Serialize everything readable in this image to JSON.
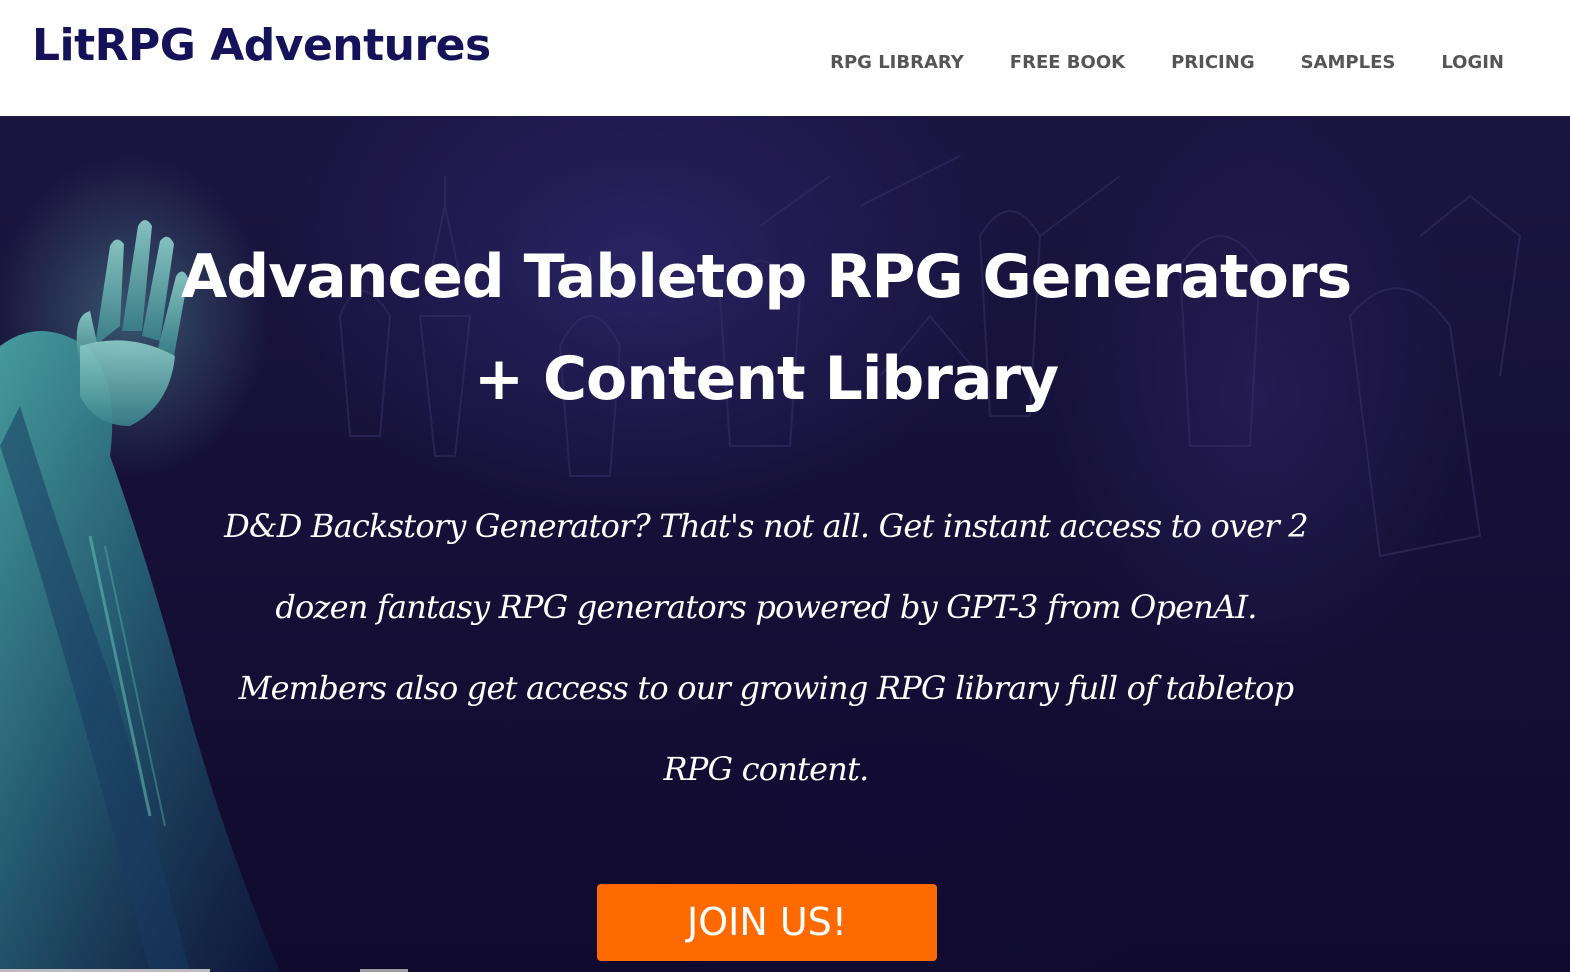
{
  "header": {
    "logo_text": "LitRPG Adventures",
    "logo_color": "#15125a",
    "nav": [
      {
        "label": "RPG LIBRARY"
      },
      {
        "label": "FREE BOOK"
      },
      {
        "label": "PRICING"
      },
      {
        "label": "SAMPLES"
      },
      {
        "label": "LOGIN"
      }
    ]
  },
  "hero": {
    "title": "Advanced Tabletop RPG Generators + Content Library",
    "description": "D&D Backstory Generator? That's not all. Get instant access to over 2 dozen fantasy RPG generators powered by GPT-3 from OpenAI. Members also get access to our growing RPG library full of tabletop RPG content.",
    "cta_label": "JOIN US!",
    "cta_color": "#ff6a00",
    "background_color": "#1e1748"
  }
}
